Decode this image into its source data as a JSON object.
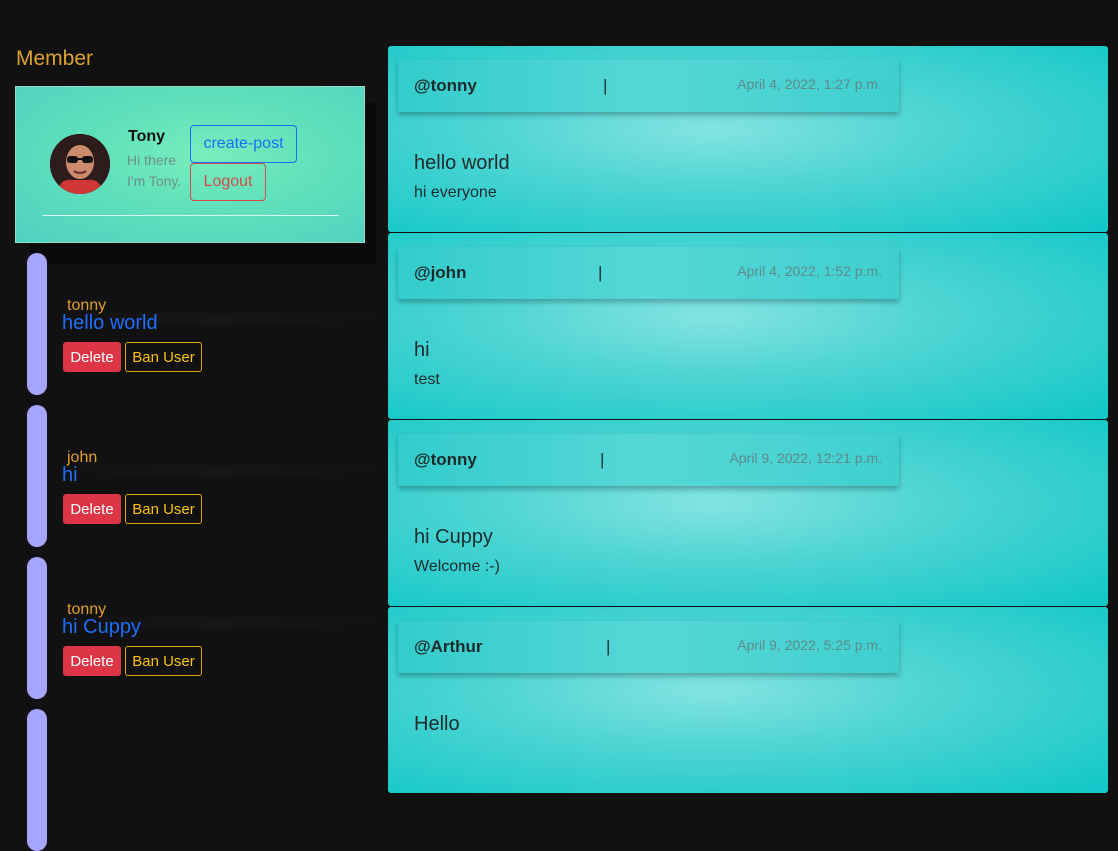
{
  "sidebar": {
    "title": "Member",
    "profile": {
      "name": "Tony",
      "bio": "Hi there I'm Tony.",
      "create_label": "create-post",
      "logout_label": "Logout"
    },
    "items": [
      {
        "author": "tonny",
        "title": "hello world",
        "delete_label": "Delete",
        "ban_label": "Ban User"
      },
      {
        "author": "john",
        "title": "hi",
        "delete_label": "Delete",
        "ban_label": "Ban User"
      },
      {
        "author": "tonny",
        "title": "hi Cuppy",
        "delete_label": "Delete",
        "ban_label": "Ban User"
      }
    ]
  },
  "posts": [
    {
      "user": "@tonny",
      "sep": "|",
      "date": "April 4, 2022, 1:27 p.m.",
      "title": "hello world",
      "body": "hi everyone"
    },
    {
      "user": "@john",
      "sep": "|",
      "date": "April 4, 2022, 1:52 p.m.",
      "title": "hi",
      "body": "test"
    },
    {
      "user": "@tonny",
      "sep": "|",
      "date": "April 9, 2022, 12:21 p.m.",
      "title": "hi Cuppy",
      "body": "Welcome :-)"
    },
    {
      "user": "@Arthur",
      "sep": "|",
      "date": "April 9, 2022, 5:25 p.m.",
      "title": "Hello",
      "body": ""
    }
  ],
  "colors": {
    "accent_orange": "#e0a030",
    "link_blue": "#1e6fff",
    "danger": "#dc3545",
    "warning": "#ffc107",
    "teal": "#10c7c7",
    "member_bar": "#a6a6ff"
  }
}
